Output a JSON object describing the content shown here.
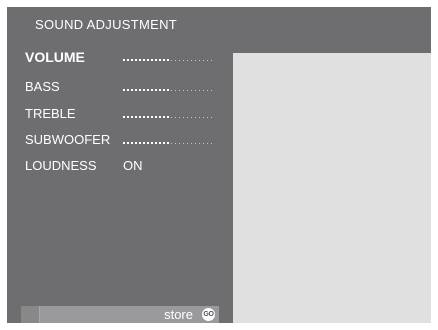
{
  "title": "SOUND ADJUSTMENT",
  "menu": [
    {
      "label": "VOLUME",
      "level": 0.5,
      "active": true
    },
    {
      "label": "BASS",
      "level": 0.5,
      "active": false
    },
    {
      "label": "TREBLE",
      "level": 0.5,
      "active": false
    },
    {
      "label": "SUBWOOFER",
      "level": 0.5,
      "active": false
    }
  ],
  "loudness": {
    "label": "LOUDNESS",
    "value": "ON"
  },
  "footer": {
    "store_label": "store",
    "go_label": "GO"
  },
  "colors": {
    "background": "#6e6e70",
    "panel": "#e0e0e1",
    "text": "#ffffff"
  }
}
